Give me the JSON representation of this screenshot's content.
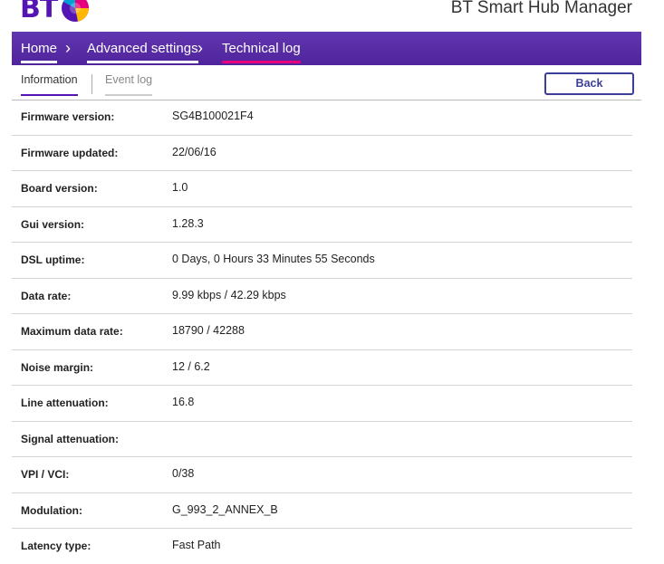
{
  "header": {
    "logo_text": "BT",
    "app_title": "BT Smart Hub Manager"
  },
  "nav": {
    "items": [
      {
        "label": "Home"
      },
      {
        "label": "Advanced settings"
      },
      {
        "label": "Technical log"
      }
    ],
    "separator": "›"
  },
  "tabs": {
    "items": [
      {
        "label": "Information"
      },
      {
        "label": "Event log"
      }
    ],
    "back_label": "Back"
  },
  "info_rows": [
    {
      "label": "Firmware version:",
      "value": "SG4B100021F4"
    },
    {
      "label": "Firmware updated:",
      "value": "22/06/16"
    },
    {
      "label": "Board version:",
      "value": "1.0"
    },
    {
      "label": "Gui version:",
      "value": "1.28.3"
    },
    {
      "label": "DSL uptime:",
      "value": "0 Days, 0 Hours 33 Minutes 55 Seconds"
    },
    {
      "label": "Data rate:",
      "value": "9.99 kbps / 42.29 kbps"
    },
    {
      "label": "Maximum data rate:",
      "value": "18790 / 42288"
    },
    {
      "label": "Noise margin:",
      "value": "12 / 6.2"
    },
    {
      "label": "Line attenuation:",
      "value": "16.8"
    },
    {
      "label": "Signal attenuation:",
      "value": ""
    },
    {
      "label": "VPI / VCI:",
      "value": "0/38"
    },
    {
      "label": "Modulation:",
      "value": "G_993_2_ANNEX_B"
    },
    {
      "label": "Latency type:",
      "value": "Fast Path"
    }
  ],
  "colors": {
    "brand_purple": "#5514b4",
    "nav_bg": "#5a2ea8",
    "active_underline": "#e6007e"
  }
}
